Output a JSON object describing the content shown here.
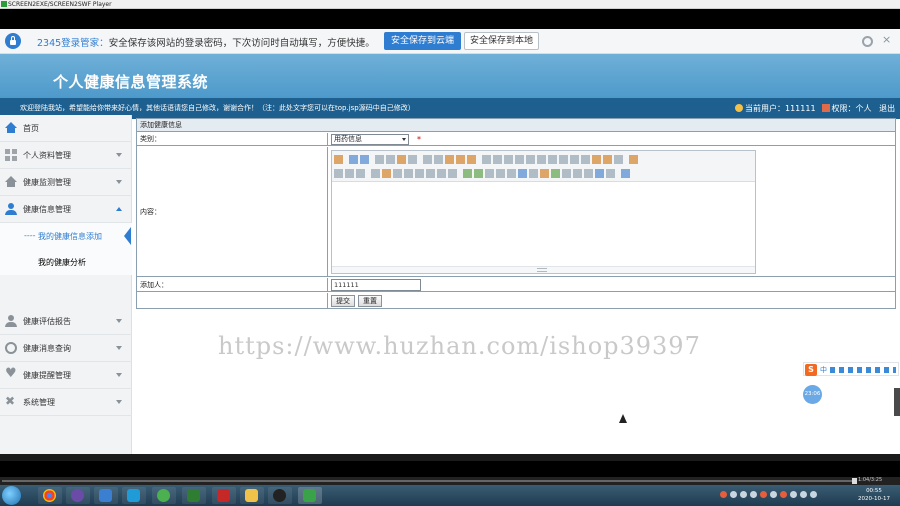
{
  "player": {
    "title": "SCREEN2EXE/SCREEN2SWF Player"
  },
  "password_bar": {
    "brand": "2345登录管家：",
    "message": "安全保存该网站的登录密码，下次访问时自动填写，方便快捷。",
    "save_cloud_label": "安全保存到云端",
    "save_local_label": "安全保存到本地",
    "close_glyph": "×"
  },
  "header": {
    "title": "个人健康信息管理系统",
    "notice": "欢迎登陆我站，希望能给你带来好心情，其他话语请您自己修改，谢谢合作！（注：此处文字您可以在top.jsp源码中自己修改）",
    "user_label": "当前用户：111111",
    "role_label": "权限：个人",
    "logout_label": "退出"
  },
  "sidebar": {
    "items": [
      {
        "label": "首页",
        "icon": "home-icon"
      },
      {
        "label": "个人资料管理",
        "icon": "grid-icon"
      },
      {
        "label": "健康监测管理",
        "icon": "house-icon"
      },
      {
        "label": "健康信息管理",
        "icon": "user-icon"
      },
      {
        "label": "健康评估报告",
        "icon": "user-icon"
      },
      {
        "label": "健康消息查询",
        "icon": "chat-icon"
      },
      {
        "label": "健康提醒管理",
        "icon": "heart-icon"
      },
      {
        "label": "系统管理",
        "icon": "tools-icon"
      }
    ],
    "sub_items": [
      {
        "label": "我的健康信息添加",
        "prefix": "----"
      },
      {
        "label": "我的健康分析"
      }
    ]
  },
  "form": {
    "caption": "添加健康信息",
    "category_label": "类别：",
    "category_value": "用药信息",
    "required_mark": "*",
    "content_label": "内容：",
    "adder_label": "添加人：",
    "adder_value": "111111",
    "submit_label": "提交",
    "reset_label": "重置"
  },
  "watermark": "https://www.huzhan.com/ishop39397",
  "ime": {
    "logo": "S",
    "mode": "中"
  },
  "bubble": "23:06",
  "taskbar": {
    "seek_time": "1:04/3:25",
    "clock_time": "00:55",
    "clock_date": "2020-10-17"
  },
  "colors": {
    "accent": "#2f7dd0",
    "header": "#3d8fc4",
    "notice_bar": "#1d5f8e"
  }
}
